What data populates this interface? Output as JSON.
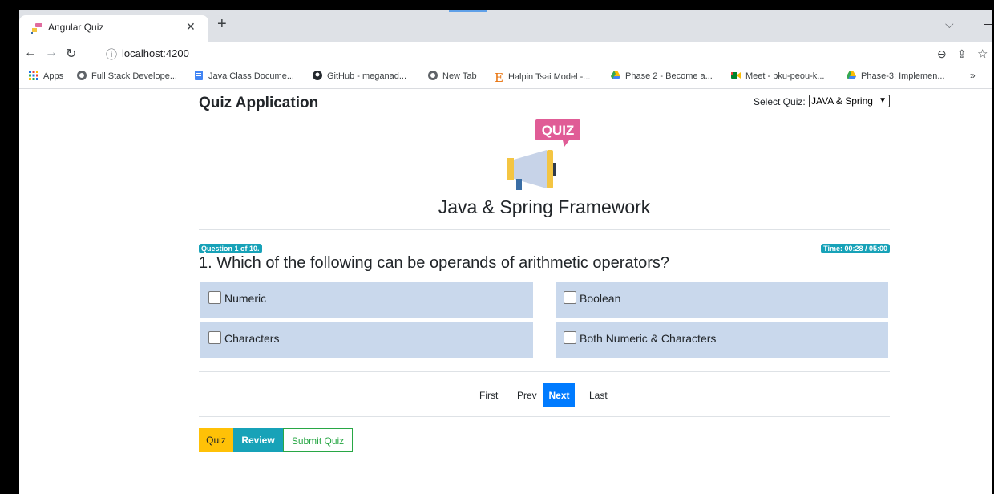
{
  "browser": {
    "tab_title": "Angular Quiz",
    "url": "localhost:4200",
    "bookmarks": [
      {
        "label": "Apps",
        "icon": "apps-grid-icon"
      },
      {
        "label": "Full Stack Develope...",
        "icon": "globe-icon"
      },
      {
        "label": "Java Class Docume...",
        "icon": "docs-icon"
      },
      {
        "label": "GitHub - meganad...",
        "icon": "github-icon"
      },
      {
        "label": "New Tab",
        "icon": "globe-icon"
      },
      {
        "label": "Halpin Tsai Model -...",
        "icon": "e-letter-icon"
      },
      {
        "label": "Phase 2 - Become a...",
        "icon": "drive-icon"
      },
      {
        "label": "Meet - bku-peou-k...",
        "icon": "meet-icon"
      },
      {
        "label": "Phase-3: Implemen...",
        "icon": "drive-icon"
      }
    ],
    "more_bookmarks": "»"
  },
  "header": {
    "title": "Quiz Application",
    "select_label": "Select Quiz:",
    "select_value": "JAVA & Spring"
  },
  "quiz": {
    "logo_text": "QUIZ",
    "name": "Java & Spring Framework",
    "progress_badge": "Question 1 of 10.",
    "timer_badge": "Time: 00:28 / 05:00",
    "question": "1. Which of the following can be operands of arithmetic operators?",
    "options": [
      {
        "label": "Numeric",
        "checked": false
      },
      {
        "label": "Boolean",
        "checked": false
      },
      {
        "label": "Characters",
        "checked": false
      },
      {
        "label": "Both Numeric & Characters",
        "checked": false
      }
    ]
  },
  "pager": {
    "first": "First",
    "prev": "Prev",
    "next": "Next",
    "last": "Last"
  },
  "actions": {
    "quiz": "Quiz",
    "review": "Review",
    "submit": "Submit Quiz"
  },
  "colors": {
    "option_bg": "#c9d8ec",
    "badge": "#17a2b8",
    "next_active": "#007bff",
    "quiz_button": "#ffc107",
    "review_button": "#17a2b8",
    "submit_border": "#28a745"
  }
}
